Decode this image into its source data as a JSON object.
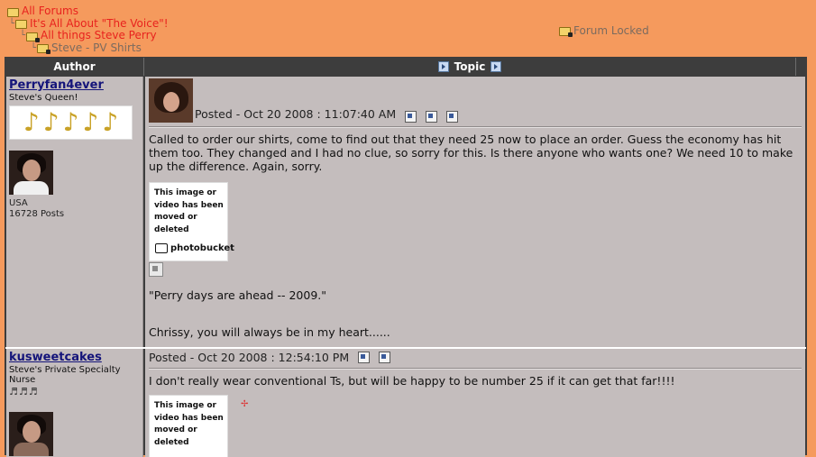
{
  "breadcrumbs": [
    {
      "label": "All Forums",
      "prefix": ""
    },
    {
      "label": "It's All About \"The Voice\"!",
      "prefix": "└"
    },
    {
      "label": "All things Steve Perry",
      "prefix": "└"
    },
    {
      "label": "Steve - PV Shirts",
      "prefix": "└"
    }
  ],
  "forum_status": "Forum Locked",
  "table": {
    "author_header": "Author",
    "topic_header": "Topic"
  },
  "posts": [
    {
      "username": "Perryfan4ever",
      "title": "Steve's Queen!",
      "location": "USA",
      "post_count": "16728 Posts",
      "posted": "Posted - Oct 20 2008 :  11:07:40 AM",
      "body": "Called to order our shirts, come to find out that they need 25 now to place an order. Guess the economy has hit them too. They changed and I had no clue, so sorry for this. Is there anyone who wants one? We need 10 to make up the difference. Again, sorry.",
      "image_placeholder_text": "This image or video has been moved or deleted",
      "image_logo": "photobucket",
      "signature_line1": "\"Perry days are ahead -- 2009.\"",
      "signature_line2": "Chrissy, you will always be in my heart......"
    },
    {
      "username": "kusweetcakes",
      "title": "Steve's Private Specialty Nurse",
      "posted": "Posted - Oct 20 2008 :  12:54:10 PM",
      "body": "I don't really wear conventional Ts, but will be happy to be number 25 if it can get that far!!!!",
      "image_placeholder_text": "This image or video has been moved or deleted"
    }
  ]
}
